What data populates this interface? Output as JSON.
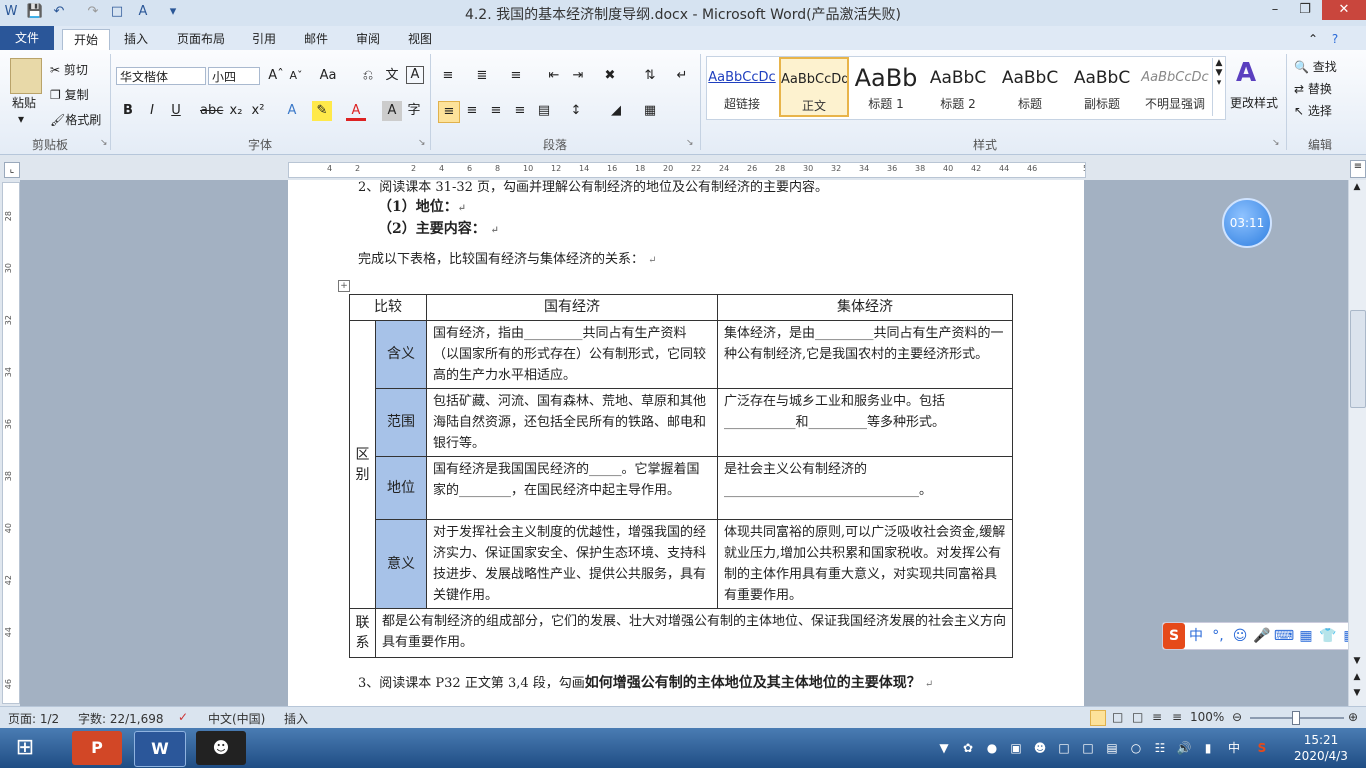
{
  "window": {
    "title": "4.2. 我国的基本经济制度导纲.docx - Microsoft Word(产品激活失败)"
  },
  "ribbon_tabs": [
    "文件",
    "开始",
    "插入",
    "页面布局",
    "引用",
    "邮件",
    "审阅",
    "视图"
  ],
  "clipboard": {
    "paste": "粘贴",
    "cut": "剪切",
    "copy": "复制",
    "format_painter": "格式刷",
    "group": "剪贴板"
  },
  "font": {
    "name": "华文楷体",
    "size": "小四",
    "group": "字体"
  },
  "paragraph": {
    "group": "段落"
  },
  "styles": {
    "items": [
      "超链接",
      "正文",
      "标题 1",
      "标题 2",
      "标题",
      "副标题",
      "不明显强调"
    ],
    "samples": [
      "AaBbCcDc",
      "AaBbCcDd",
      "AaBb",
      "AaBbC",
      "AaBbC",
      "AaBbC",
      "AaBbCcDc"
    ],
    "change": "更改样式",
    "group": "样式"
  },
  "editing": {
    "find": "查找",
    "replace": "替换",
    "select": "选择",
    "group": "编辑"
  },
  "ruler": {
    "h_ticks": [
      "4",
      "2",
      "",
      "2",
      "4",
      "6",
      "8",
      "10",
      "12",
      "14",
      "16",
      "18",
      "20",
      "22",
      "24",
      "26",
      "28",
      "30",
      "32",
      "34",
      "36",
      "38",
      "40",
      "42",
      "44",
      "46",
      "",
      "50"
    ],
    "v_ticks": [
      "28",
      "30",
      "32",
      "34",
      "36",
      "38",
      "40",
      "42",
      "44",
      "46"
    ]
  },
  "doc": {
    "line1": "2、阅读课本 31-32 页，勾画并理解公有制经济的地位及公有制经济的主要内容。",
    "line2": "（1）地位：",
    "line3": "（2）主要内容：",
    "instruction": "完成以下表格，比较国有经济与集体经济的关系：",
    "line_last_prefix": "3、阅读课本 P32 正文第 3,4 段，勾画",
    "line_last_bold": "如何增强公有制的主体地位及其主体地位的主要体现？"
  },
  "table": {
    "header": [
      "比较",
      "国有经济",
      "集体经济"
    ],
    "diff_label": "区别",
    "rows": [
      {
        "label": "含义",
        "state": "国有经济，指由_________共同占有生产资料（以国家所有的形式存在）公有制形式，它同较高的生产力水平相适应。",
        "collective": "集体经济，是由_________共同占有生产资料的一种公有制经济,它是我国农村的主要经济形式。"
      },
      {
        "label": "范围",
        "state": "包括矿藏、河流、国有森林、荒地、草原和其他海陆自然资源，还包括全民所有的铁路、邮电和银行等。",
        "collective": "广泛存在与城乡工业和服务业中。包括___________和_________等多种形式。"
      },
      {
        "label": "地位",
        "state": "国有经济是我国国民经济的_____。它掌握着国家的________，在国民经济中起主导作用。",
        "collective": "是社会主义公有制经济的______________________________。"
      },
      {
        "label": "意义",
        "state": "对于发挥社会主义制度的优越性，增强我国的经济实力、保证国家安全、保护生态环境、支持科技进步、发展战略性产业、提供公共服务，具有关键作用。",
        "collective": "体现共同富裕的原则,可以广泛吸收社会资金,缓解就业压力,增加公共积累和国家税收。对发挥公有制的主体作用具有重大意义，对实现共同富裕具有重要作用。"
      }
    ],
    "relation_label": "联系",
    "relation": "都是公有制经济的组成部分，它们的发展、壮大对增强公有制的主体地位、保证我国经济发展的社会主义方向具有重要作用。"
  },
  "timer": "03:11",
  "status": {
    "page": "页面: 1/2",
    "words": "字数: 22/1,698",
    "lang": "中文(中国)",
    "mode": "插入",
    "zoom": "100%"
  },
  "clock": {
    "time": "15:21",
    "date": "2020/4/3"
  },
  "colors": {
    "file_tab": "#2a5699",
    "table_label_bg": "#a7c2e8",
    "style_selected_border": "#e8b44a"
  }
}
